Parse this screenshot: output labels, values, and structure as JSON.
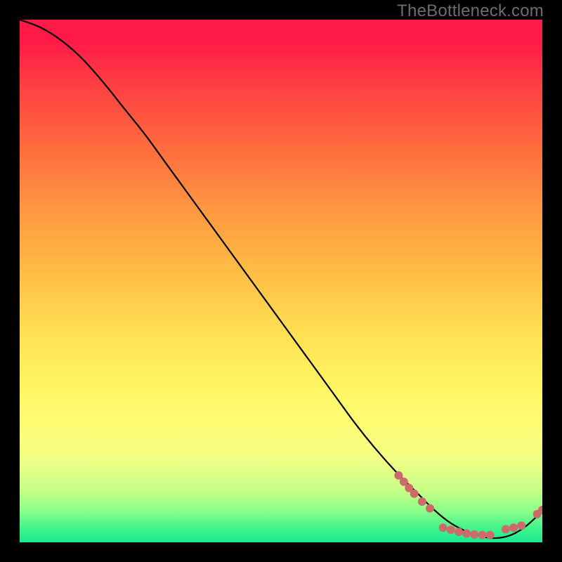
{
  "watermark": "TheBottleneck.com",
  "chart_data": {
    "type": "line",
    "title": "",
    "xlabel": "",
    "ylabel": "",
    "xlim": [
      0,
      100
    ],
    "ylim": [
      0,
      100
    ],
    "grid": false,
    "series": [
      {
        "name": "curve",
        "x": [
          0,
          4,
          8,
          12,
          16,
          20,
          24,
          28,
          32,
          36,
          40,
          44,
          48,
          52,
          56,
          60,
          64,
          68,
          72,
          76,
          79,
          82,
          85,
          88,
          91,
          94,
          97,
          100
        ],
        "y": [
          100,
          98.5,
          96,
          92.5,
          88,
          83,
          78,
          72.5,
          67,
          61.5,
          56,
          50.5,
          45,
          39.5,
          34,
          28.5,
          23,
          18,
          13.5,
          9.5,
          6.5,
          4,
          2.3,
          1.2,
          0.8,
          1.4,
          3.2,
          6
        ]
      }
    ],
    "markers": [
      {
        "x": 72.5,
        "y": 12.8
      },
      {
        "x": 73.5,
        "y": 11.6
      },
      {
        "x": 74.5,
        "y": 10.4
      },
      {
        "x": 75.5,
        "y": 9.3
      },
      {
        "x": 77.0,
        "y": 7.8
      },
      {
        "x": 78.5,
        "y": 6.5
      },
      {
        "x": 81.0,
        "y": 2.8
      },
      {
        "x": 82.5,
        "y": 2.4
      },
      {
        "x": 84.0,
        "y": 2.0
      },
      {
        "x": 85.5,
        "y": 1.7
      },
      {
        "x": 87.0,
        "y": 1.5
      },
      {
        "x": 88.5,
        "y": 1.4
      },
      {
        "x": 90.0,
        "y": 1.4
      },
      {
        "x": 93.0,
        "y": 2.5
      },
      {
        "x": 94.5,
        "y": 2.8
      },
      {
        "x": 96.0,
        "y": 3.2
      },
      {
        "x": 99.0,
        "y": 5.4
      },
      {
        "x": 100.0,
        "y": 6.2
      }
    ],
    "line_color": "#000000",
    "marker_color": "#cd6b6b",
    "marker_radius": 6
  }
}
